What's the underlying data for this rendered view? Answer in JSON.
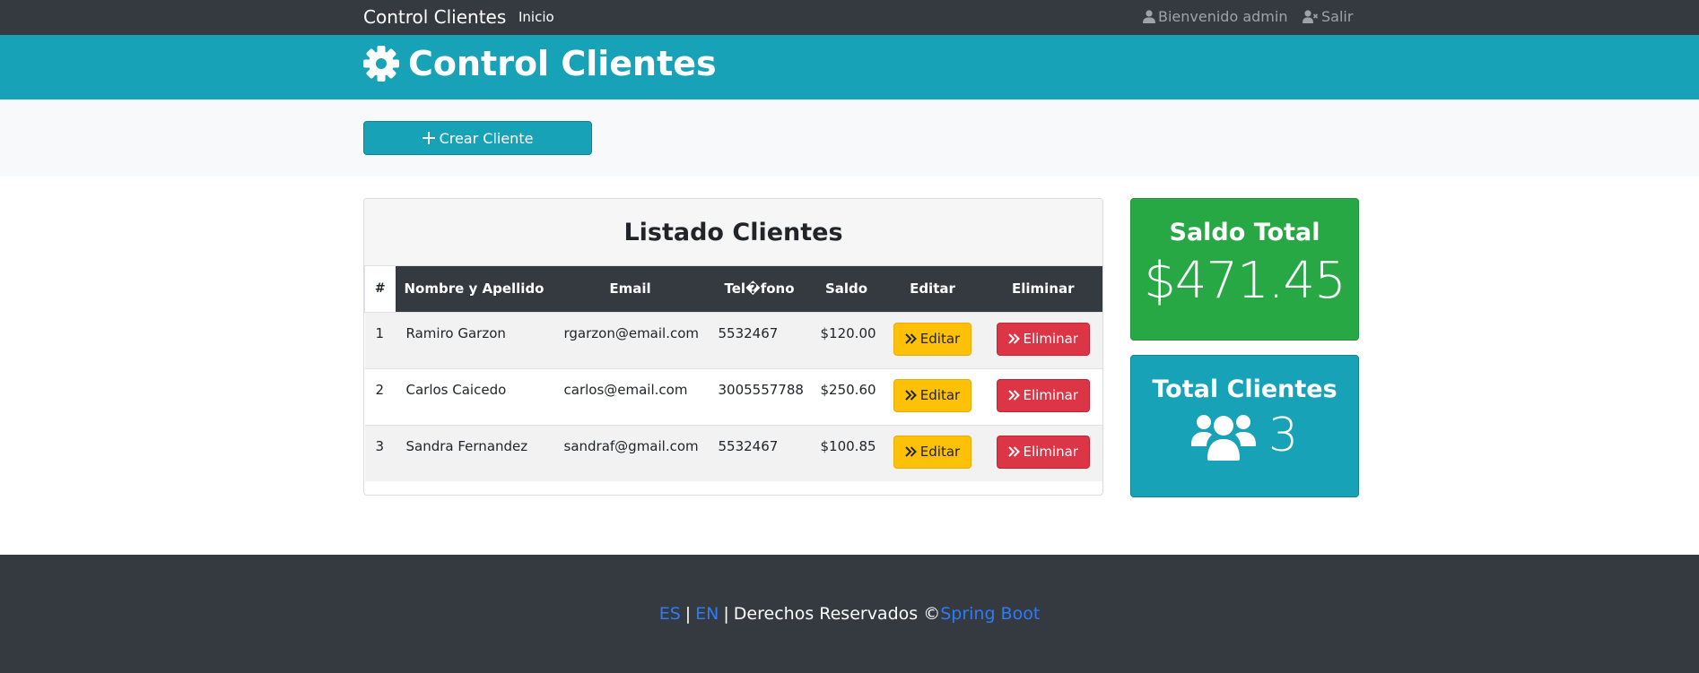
{
  "navbar": {
    "brand": "Control Clientes",
    "home": "Inicio",
    "welcome": "Bienvenido admin",
    "logout": "Salir"
  },
  "header": {
    "title": "Control Clientes",
    "icon": "gear-icon"
  },
  "actions": {
    "create_label": "Crear Cliente"
  },
  "list": {
    "title": "Listado Clientes",
    "columns": [
      "#",
      "Nombre y Apellido",
      "Email",
      "Tel�fono",
      "Saldo",
      "Editar",
      "Eliminar"
    ],
    "rows": [
      {
        "num": "1",
        "name": "Ramiro Garzon",
        "email": "rgarzon@email.com",
        "phone": "5532467",
        "saldo": "$120.00",
        "edit": "Editar",
        "delete": "Eliminar"
      },
      {
        "num": "2",
        "name": "Carlos Caicedo",
        "email": "carlos@email.com",
        "phone": "3005557788",
        "saldo": "$250.60",
        "edit": "Editar",
        "delete": "Eliminar"
      },
      {
        "num": "3",
        "name": "Sandra Fernandez",
        "email": "sandraf@gmail.com",
        "phone": "5532467",
        "saldo": "$100.85",
        "edit": "Editar",
        "delete": "Eliminar"
      }
    ]
  },
  "stats": {
    "saldo_title": "Saldo Total",
    "saldo_value": "$471.45",
    "clients_title": "Total Clientes",
    "clients_value": "3"
  },
  "footer": {
    "lang_es": "ES",
    "lang_en": "EN",
    "rights": "Derechos Reservados ©",
    "link": "Spring Boot"
  },
  "colors": {
    "navbar": "#343a40",
    "info": "#17a2b8",
    "success": "#28a745",
    "warning": "#ffc107",
    "danger": "#dc3545",
    "link": "#2f7bf5"
  }
}
